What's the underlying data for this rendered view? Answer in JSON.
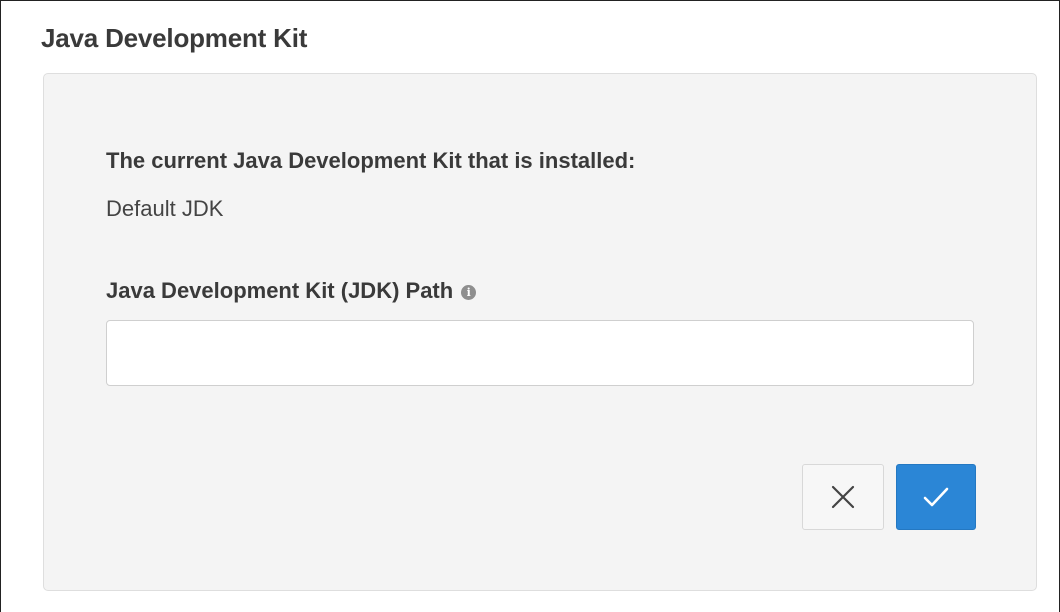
{
  "section": {
    "title": "Java Development Kit"
  },
  "panel": {
    "current_label": "The current Java Development Kit that is installed:",
    "current_value": "Default JDK",
    "path_label": "Java Development Kit (JDK) Path",
    "path_info_icon": "info-icon",
    "path_input": {
      "value": "",
      "placeholder": ""
    },
    "actions": {
      "cancel_icon": "close-icon",
      "confirm_icon": "check-icon"
    }
  },
  "colors": {
    "accent": "#2b86d6",
    "panel_background": "#f4f4f4",
    "title_text": "#3a3a3a"
  }
}
